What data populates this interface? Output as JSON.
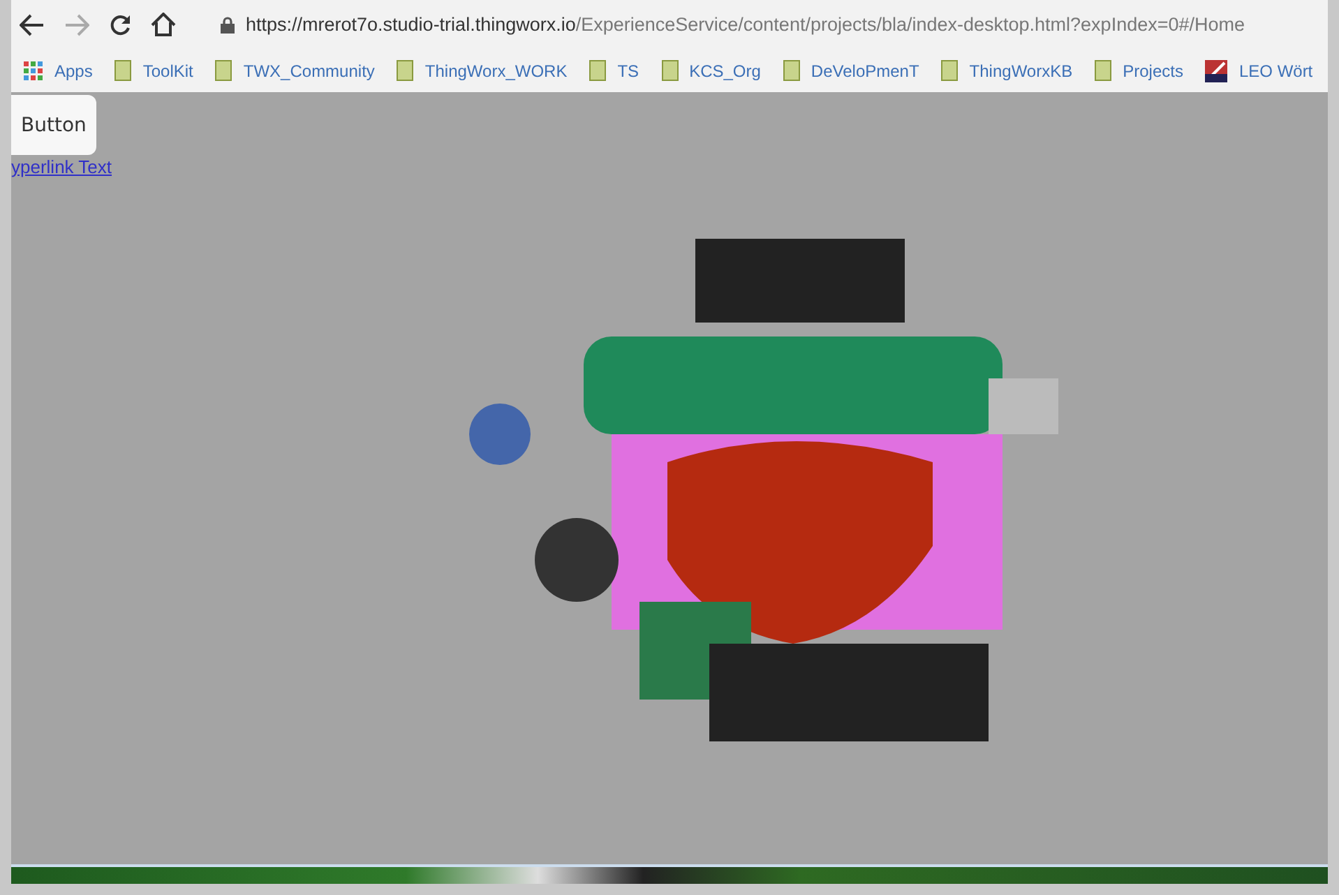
{
  "address_bar": {
    "url_host": "https://mrerot7o.studio-trial.thingworx.io",
    "url_path": "/ExperienceService/content/projects/bla/index-desktop.html?expIndex=0#/Home",
    "forward_disabled": true
  },
  "bookmarks": [
    {
      "label": "Apps",
      "kind": "apps"
    },
    {
      "label": "ToolKit",
      "kind": "folder"
    },
    {
      "label": "TWX_Community",
      "kind": "folder"
    },
    {
      "label": "ThingWorx_WORK",
      "kind": "folder"
    },
    {
      "label": "TS",
      "kind": "folder"
    },
    {
      "label": "KCS_Org",
      "kind": "folder"
    },
    {
      "label": "DeVeloPmenT",
      "kind": "folder"
    },
    {
      "label": "ThingWorxKB",
      "kind": "folder"
    },
    {
      "label": "Projects",
      "kind": "folder"
    },
    {
      "label": "LEO Wört",
      "kind": "site"
    }
  ],
  "page": {
    "button": "Button",
    "link": "yperlink Text"
  }
}
